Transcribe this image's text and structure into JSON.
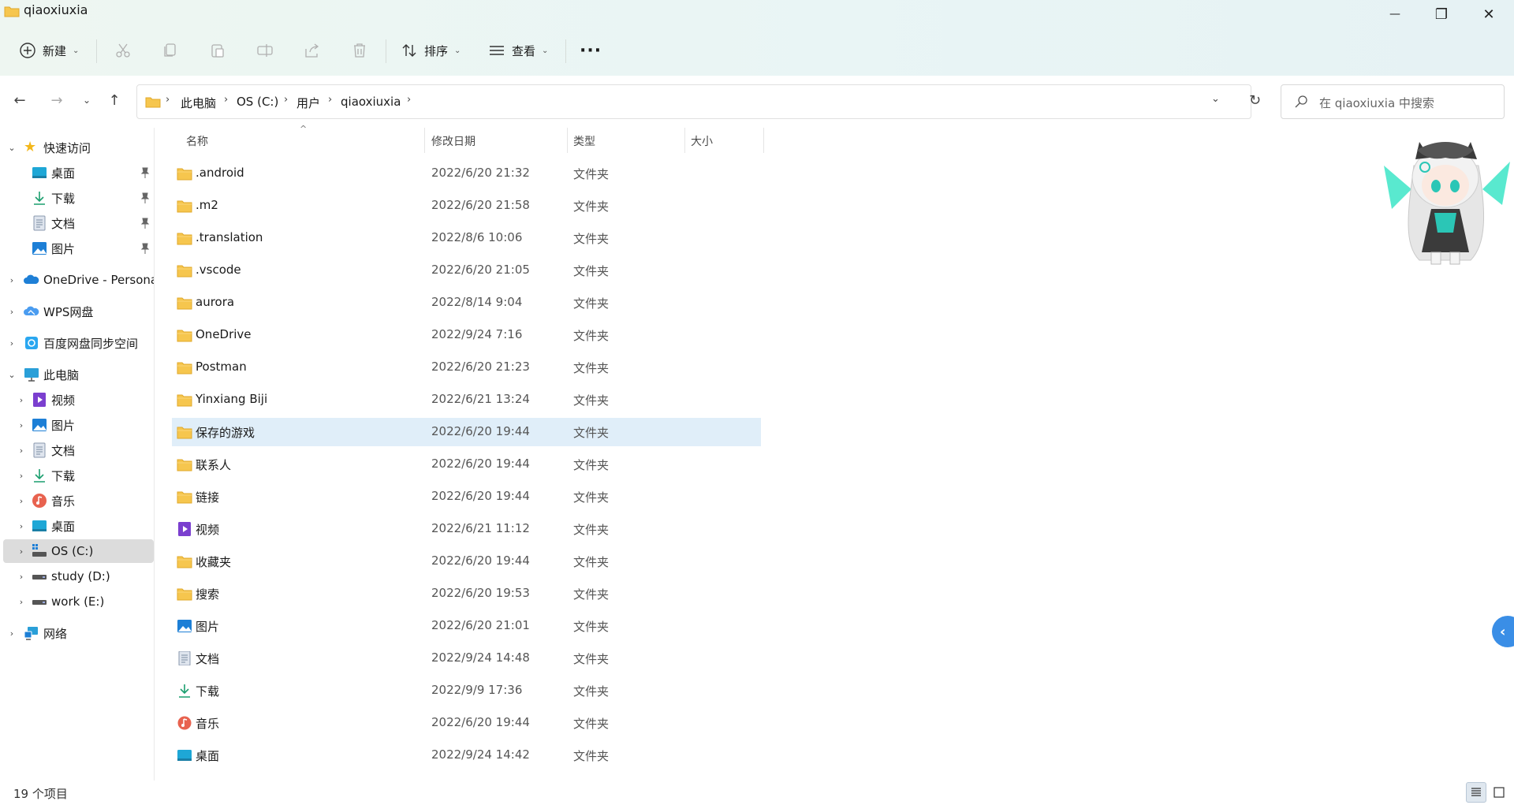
{
  "window": {
    "title": "qiaoxiuxia",
    "minimize_glyph": "—",
    "maximize_glyph": "❐",
    "close_glyph": "✕"
  },
  "toolbar": {
    "new_label": "新建",
    "sort_label": "排序",
    "view_label": "查看",
    "more_glyph": "···",
    "icons": [
      "new-icon",
      "cut-icon",
      "copy-icon",
      "paste-icon",
      "rename-icon",
      "share-icon",
      "delete-icon",
      "sort-icon",
      "view-icon",
      "more-icon"
    ]
  },
  "address": {
    "crumbs": [
      "此电脑",
      "OS (C:)",
      "用户",
      "qiaoxiuxia"
    ],
    "search_placeholder": "在 qiaoxiuxia 中搜索"
  },
  "nav": {
    "quick_access": "快速访问",
    "quick_items": [
      "桌面",
      "下载",
      "文档",
      "图片"
    ],
    "onedrive": "OneDrive - Persona",
    "wps": "WPS网盘",
    "baidu": "百度网盘同步空间",
    "this_pc": "此电脑",
    "pc_items": [
      "视频",
      "图片",
      "文档",
      "下载",
      "音乐",
      "桌面",
      "OS (C:)",
      "study (D:)",
      "work (E:)"
    ],
    "network": "网络"
  },
  "columns": {
    "name": "名称",
    "date": "修改日期",
    "type": "类型",
    "size": "大小"
  },
  "files": [
    {
      "name": ".android",
      "date": "2022/6/20 21:32",
      "type": "文件夹",
      "icon": "folder"
    },
    {
      "name": ".m2",
      "date": "2022/6/20 21:58",
      "type": "文件夹",
      "icon": "folder"
    },
    {
      "name": ".translation",
      "date": "2022/8/6 10:06",
      "type": "文件夹",
      "icon": "folder"
    },
    {
      "name": ".vscode",
      "date": "2022/6/20 21:05",
      "type": "文件夹",
      "icon": "folder"
    },
    {
      "name": "aurora",
      "date": "2022/8/14 9:04",
      "type": "文件夹",
      "icon": "folder"
    },
    {
      "name": "OneDrive",
      "date": "2022/9/24 7:16",
      "type": "文件夹",
      "icon": "folder"
    },
    {
      "name": "Postman",
      "date": "2022/6/20 21:23",
      "type": "文件夹",
      "icon": "folder"
    },
    {
      "name": "Yinxiang Biji",
      "date": "2022/6/21 13:24",
      "type": "文件夹",
      "icon": "folder"
    },
    {
      "name": "保存的游戏",
      "date": "2022/6/20 19:44",
      "type": "文件夹",
      "icon": "folder"
    },
    {
      "name": "联系人",
      "date": "2022/6/20 19:44",
      "type": "文件夹",
      "icon": "folder"
    },
    {
      "name": "链接",
      "date": "2022/6/20 19:44",
      "type": "文件夹",
      "icon": "folder"
    },
    {
      "name": "视频",
      "date": "2022/6/21 11:12",
      "type": "文件夹",
      "icon": "video"
    },
    {
      "name": "收藏夹",
      "date": "2022/6/20 19:44",
      "type": "文件夹",
      "icon": "folder"
    },
    {
      "name": "搜索",
      "date": "2022/6/20 19:53",
      "type": "文件夹",
      "icon": "folder"
    },
    {
      "name": "图片",
      "date": "2022/6/20 21:01",
      "type": "文件夹",
      "icon": "picture"
    },
    {
      "name": "文档",
      "date": "2022/9/24 14:48",
      "type": "文件夹",
      "icon": "document"
    },
    {
      "name": "下载",
      "date": "2022/9/9 17:36",
      "type": "文件夹",
      "icon": "download"
    },
    {
      "name": "音乐",
      "date": "2022/6/20 19:44",
      "type": "文件夹",
      "icon": "music"
    },
    {
      "name": "桌面",
      "date": "2022/9/24 14:42",
      "type": "文件夹",
      "icon": "desktop"
    }
  ],
  "selected_row": 8,
  "status": {
    "item_count": "19 个项目"
  },
  "colors": {
    "folder": "#f6c64e",
    "folder_dark": "#e8a920",
    "selection": "#e0eef9",
    "accent": "#0067c0"
  }
}
